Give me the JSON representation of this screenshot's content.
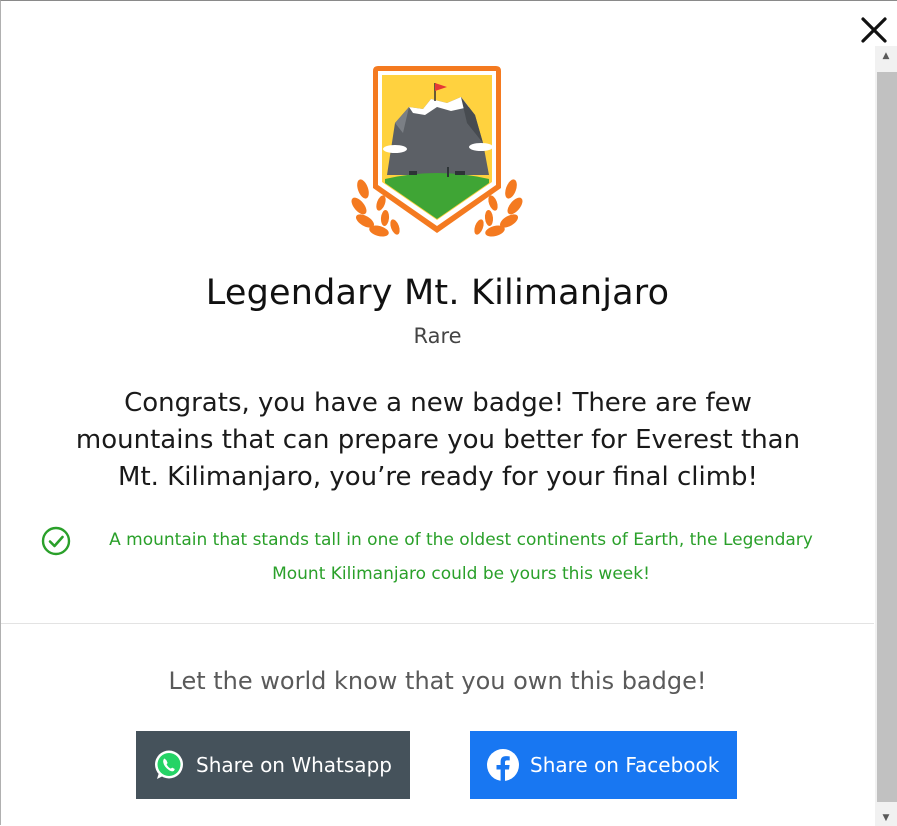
{
  "modal": {
    "close_label": "Close"
  },
  "badge": {
    "title": "Legendary Mt. Kilimanjaro",
    "rarity": "Rare",
    "message": "Congrats, you have a new badge! There are few mountains that can prepare you better for Everest than Mt. Kilimanjaro, you’re ready for your final climb!",
    "note": "A mountain that stands tall in one of the oldest continents of Earth, the Legendary Mount Kilimanjaro could be yours this week!"
  },
  "share": {
    "prompt": "Let the world know that you own this badge!",
    "whatsapp_label": "Share on Whatsapp",
    "facebook_label": "Share on Facebook"
  },
  "colors": {
    "success_green": "#2aa02a",
    "whatsapp_button": "#45525b",
    "facebook_button": "#1877f2"
  },
  "icons": {
    "close": "close-icon",
    "check": "check-circle-icon",
    "whatsapp": "whatsapp-icon",
    "facebook": "facebook-icon"
  }
}
